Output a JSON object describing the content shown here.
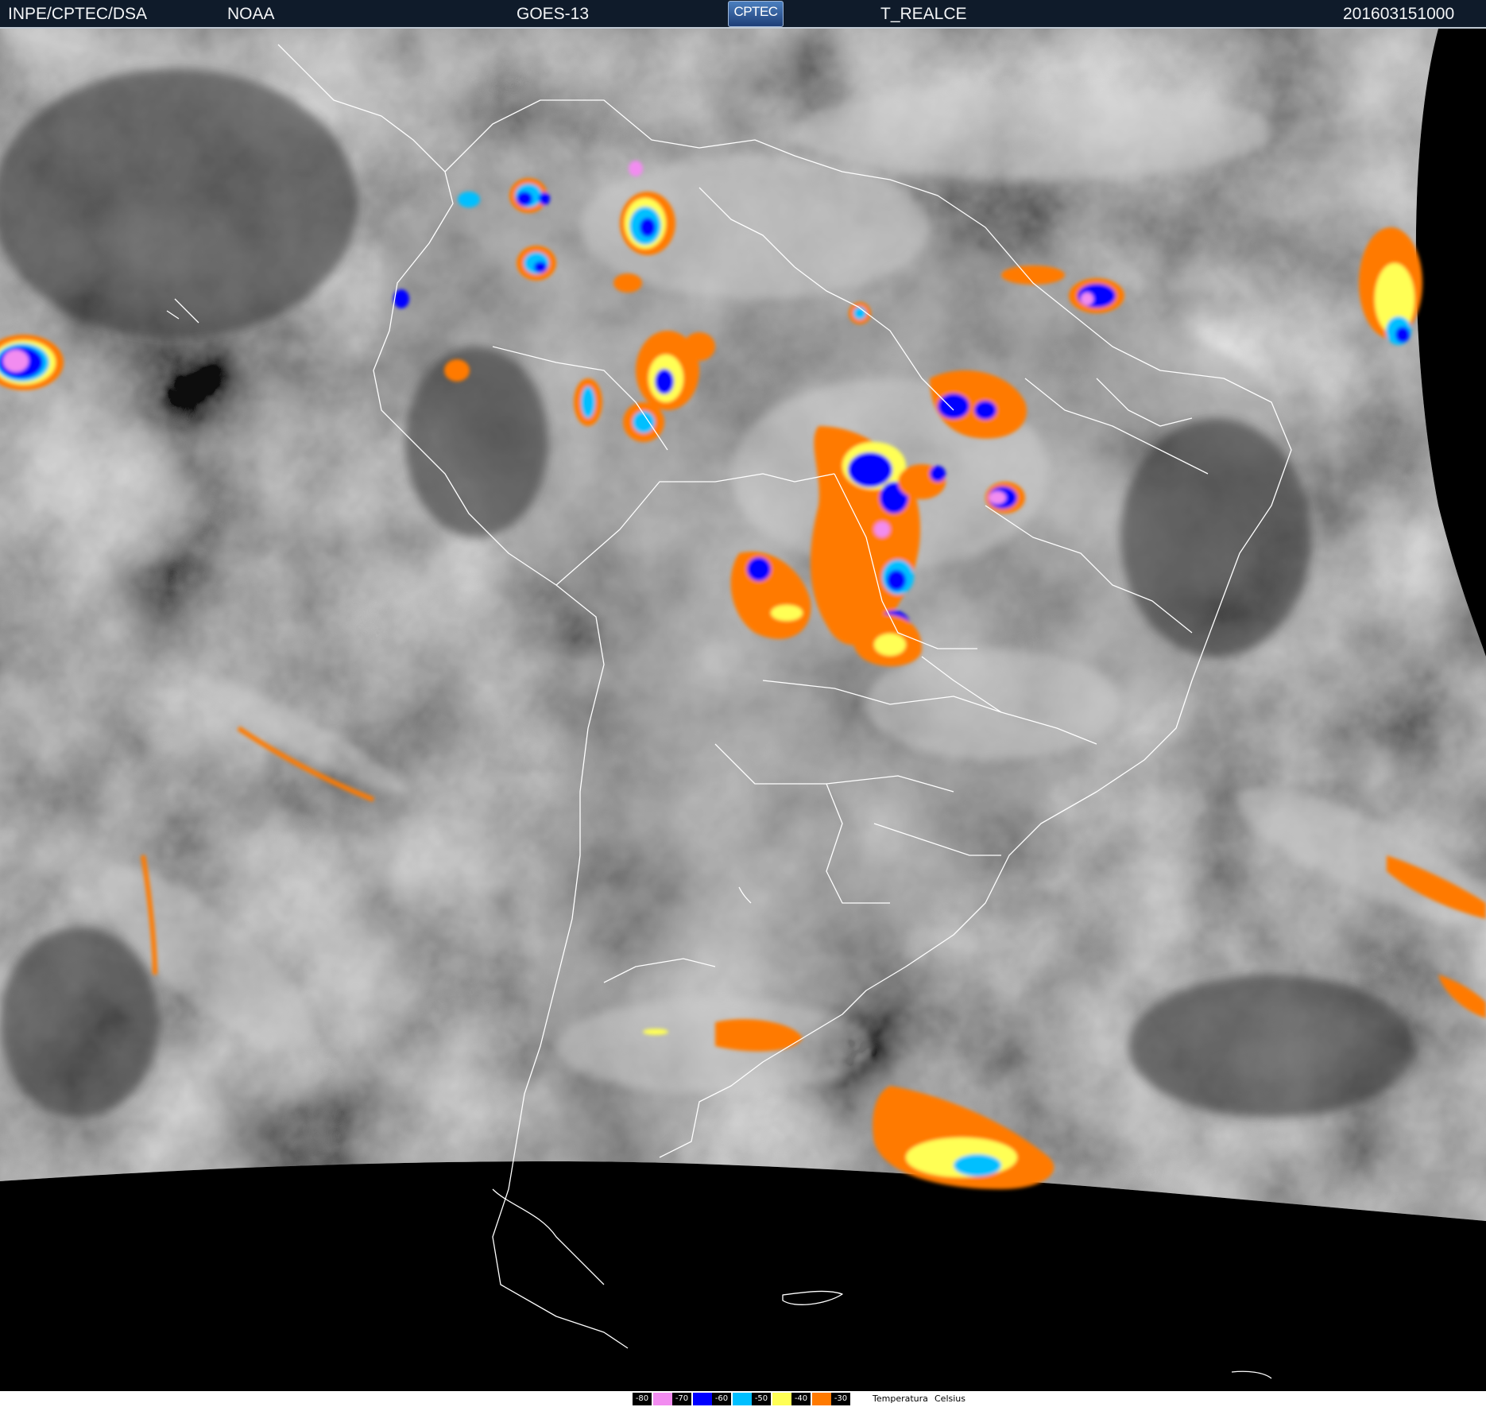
{
  "header": {
    "institution": "INPE/CPTEC/DSA",
    "agency": "NOAA",
    "satellite": "GOES-13",
    "logo_text": "CPTEC",
    "product": "T_REALCE",
    "timestamp": "201603151000"
  },
  "legend": {
    "levels": [
      {
        "label": "-80",
        "color": "#f28cf0"
      },
      {
        "label": "-70",
        "color": "#0000ff"
      },
      {
        "label": "-60",
        "color": "#00bfff"
      },
      {
        "label": "-50",
        "color": "#ffff55"
      },
      {
        "label": "-40",
        "color": "#ff7a00"
      },
      {
        "label": "-30",
        "color": null
      }
    ],
    "title_1": "Temperatura",
    "title_2": "Celsius"
  },
  "map": {
    "colors": {
      "pink": "#f28cf0",
      "blue": "#0000ff",
      "cyan": "#00bfff",
      "yellow": "#ffff55",
      "orange": "#ff7a00",
      "border_lines": "#ffffff",
      "space": "#000000"
    }
  }
}
